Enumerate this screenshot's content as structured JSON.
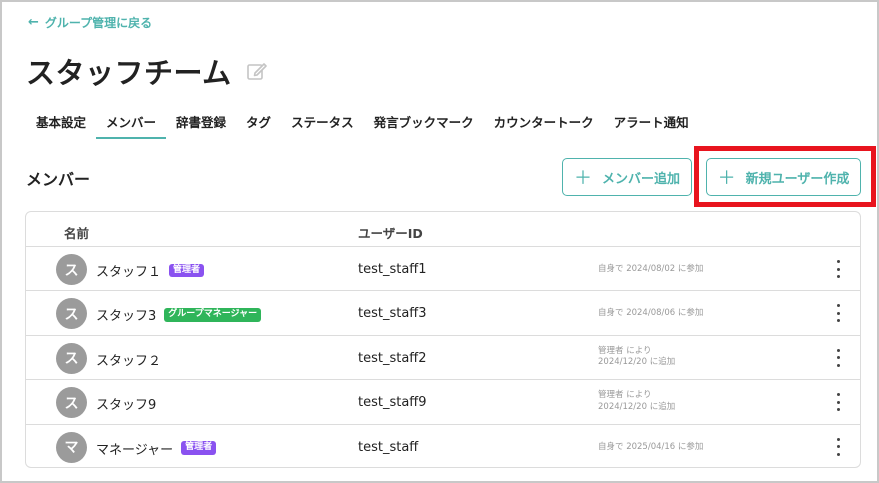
{
  "back_link": {
    "label": "グループ管理に戻る"
  },
  "page": {
    "title": "スタッフチーム"
  },
  "tabs": [
    {
      "label": "基本設定"
    },
    {
      "label": "メンバー",
      "active": true
    },
    {
      "label": "辞書登録"
    },
    {
      "label": "タグ"
    },
    {
      "label": "ステータス"
    },
    {
      "label": "発言ブックマーク"
    },
    {
      "label": "カウンタートーク"
    },
    {
      "label": "アラート通知"
    }
  ],
  "section": {
    "title": "メンバー"
  },
  "actions": {
    "add_member_label": "メンバー追加",
    "new_user_label": "新規ユーザー作成"
  },
  "table": {
    "headers": {
      "name": "名前",
      "user_id": "ユーザーID"
    },
    "rows": [
      {
        "initial": "ス",
        "name": "スタッフ１",
        "badge": "管理者",
        "badge_type": "admin",
        "user_id": "test_staff1",
        "join_line1": "自身で 2024/08/02 に参加",
        "join_line2": ""
      },
      {
        "initial": "ス",
        "name": "スタッフ3",
        "badge": "グループマネージャー",
        "badge_type": "manager",
        "user_id": "test_staff3",
        "join_line1": "自身で 2024/08/06 に参加",
        "join_line2": ""
      },
      {
        "initial": "ス",
        "name": "スタッフ２",
        "badge": "",
        "badge_type": "",
        "user_id": "test_staff2",
        "join_line1": "管理者 により",
        "join_line2": "2024/12/20 に追加"
      },
      {
        "initial": "ス",
        "name": "スタッフ9",
        "badge": "",
        "badge_type": "",
        "user_id": "test_staff9",
        "join_line1": "管理者 により",
        "join_line2": "2024/12/20 に追加"
      },
      {
        "initial": "マ",
        "name": "マネージャー",
        "badge": "管理者",
        "badge_type": "admin",
        "user_id": "test_staff",
        "join_line1": "自身で 2025/04/16 に参加",
        "join_line2": ""
      }
    ]
  },
  "colors": {
    "accent": "#4fb3ad",
    "highlight": "#e8141e",
    "admin_badge": "#8a52f0",
    "manager_badge": "#2fb55a",
    "avatar": "#9b9b9b"
  },
  "icons": {
    "back": "arrow-left-icon",
    "edit": "edit-icon",
    "add": "plus-icon",
    "row_menu": "more-vertical-icon"
  }
}
